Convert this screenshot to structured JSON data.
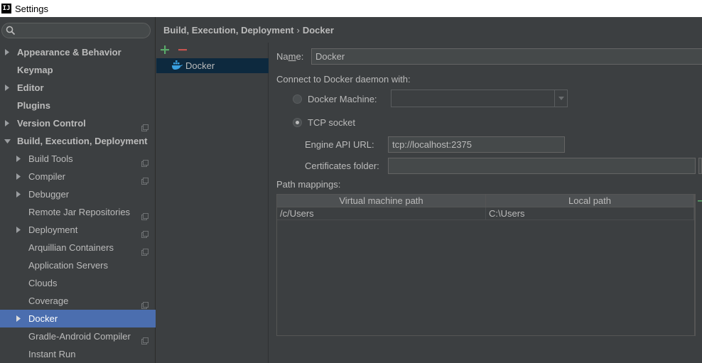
{
  "window": {
    "title": "Settings",
    "app_icon_text": "IJ"
  },
  "search": {
    "placeholder": ""
  },
  "sidebar": {
    "items": [
      {
        "label": "Appearance & Behavior",
        "level": 0,
        "bold": true,
        "arrow": "right",
        "proj": false,
        "selected": false,
        "name": "sidebar-item-appearance-behavior"
      },
      {
        "label": "Keymap",
        "level": 0,
        "bold": true,
        "arrow": "none",
        "proj": false,
        "selected": false,
        "name": "sidebar-item-keymap"
      },
      {
        "label": "Editor",
        "level": 0,
        "bold": true,
        "arrow": "right",
        "proj": false,
        "selected": false,
        "name": "sidebar-item-editor"
      },
      {
        "label": "Plugins",
        "level": 0,
        "bold": true,
        "arrow": "none",
        "proj": false,
        "selected": false,
        "name": "sidebar-item-plugins"
      },
      {
        "label": "Version Control",
        "level": 0,
        "bold": true,
        "arrow": "right",
        "proj": true,
        "selected": false,
        "name": "sidebar-item-version-control"
      },
      {
        "label": "Build, Execution, Deployment",
        "level": 0,
        "bold": true,
        "arrow": "down",
        "proj": false,
        "selected": false,
        "name": "sidebar-item-build-execution-deployment"
      },
      {
        "label": "Build Tools",
        "level": 1,
        "bold": false,
        "arrow": "right",
        "proj": true,
        "selected": false,
        "name": "sidebar-item-build-tools"
      },
      {
        "label": "Compiler",
        "level": 1,
        "bold": false,
        "arrow": "right",
        "proj": true,
        "selected": false,
        "name": "sidebar-item-compiler"
      },
      {
        "label": "Debugger",
        "level": 1,
        "bold": false,
        "arrow": "right",
        "proj": false,
        "selected": false,
        "name": "sidebar-item-debugger"
      },
      {
        "label": "Remote Jar Repositories",
        "level": 1,
        "bold": false,
        "arrow": "none",
        "proj": true,
        "selected": false,
        "name": "sidebar-item-remote-jar-repositories"
      },
      {
        "label": "Deployment",
        "level": 1,
        "bold": false,
        "arrow": "right",
        "proj": true,
        "selected": false,
        "name": "sidebar-item-deployment"
      },
      {
        "label": "Arquillian Containers",
        "level": 1,
        "bold": false,
        "arrow": "none",
        "proj": true,
        "selected": false,
        "name": "sidebar-item-arquillian-containers"
      },
      {
        "label": "Application Servers",
        "level": 1,
        "bold": false,
        "arrow": "none",
        "proj": false,
        "selected": false,
        "name": "sidebar-item-application-servers"
      },
      {
        "label": "Clouds",
        "level": 1,
        "bold": false,
        "arrow": "none",
        "proj": false,
        "selected": false,
        "name": "sidebar-item-clouds"
      },
      {
        "label": "Coverage",
        "level": 1,
        "bold": false,
        "arrow": "none",
        "proj": true,
        "selected": false,
        "name": "sidebar-item-coverage"
      },
      {
        "label": "Docker",
        "level": 1,
        "bold": false,
        "arrow": "right",
        "proj": false,
        "selected": true,
        "name": "sidebar-item-docker"
      },
      {
        "label": "Gradle-Android Compiler",
        "level": 1,
        "bold": false,
        "arrow": "none",
        "proj": true,
        "selected": false,
        "name": "sidebar-item-gradle-android-compiler"
      },
      {
        "label": "Instant Run",
        "level": 1,
        "bold": false,
        "arrow": "none",
        "proj": false,
        "selected": false,
        "name": "sidebar-item-instant-run"
      }
    ]
  },
  "breadcrumb": {
    "parent": "Build, Execution, Deployment",
    "separator": "›",
    "current": "Docker"
  },
  "list": {
    "items": [
      {
        "label": "Docker"
      }
    ]
  },
  "form": {
    "name_label_prefix": "Na",
    "name_label_mnemonic": "m",
    "name_label_suffix": "e:",
    "name_value": "Docker",
    "connect_label": "Connect to Docker daemon with:",
    "docker_machine_label": "Docker Machine:",
    "docker_machine_value": "",
    "tcp_socket_label": "TCP socket",
    "selected_connection": "TCP socket",
    "engine_api_url_label": "Engine API URL:",
    "engine_api_url_value": "tcp://localhost:2375",
    "certificates_folder_label": "Certificates folder:",
    "certificates_folder_value": "",
    "path_mappings_label": "Path mappings:"
  },
  "path_mappings": {
    "columns": [
      "Virtual machine path",
      "Local path"
    ],
    "rows": [
      [
        "/c/Users",
        "C:\\Users"
      ]
    ]
  },
  "colors": {
    "accent_selected": "#4b6eaf",
    "add_green": "#59a869",
    "remove_red": "#c75450",
    "docker_blue": "#3aa0e0"
  }
}
